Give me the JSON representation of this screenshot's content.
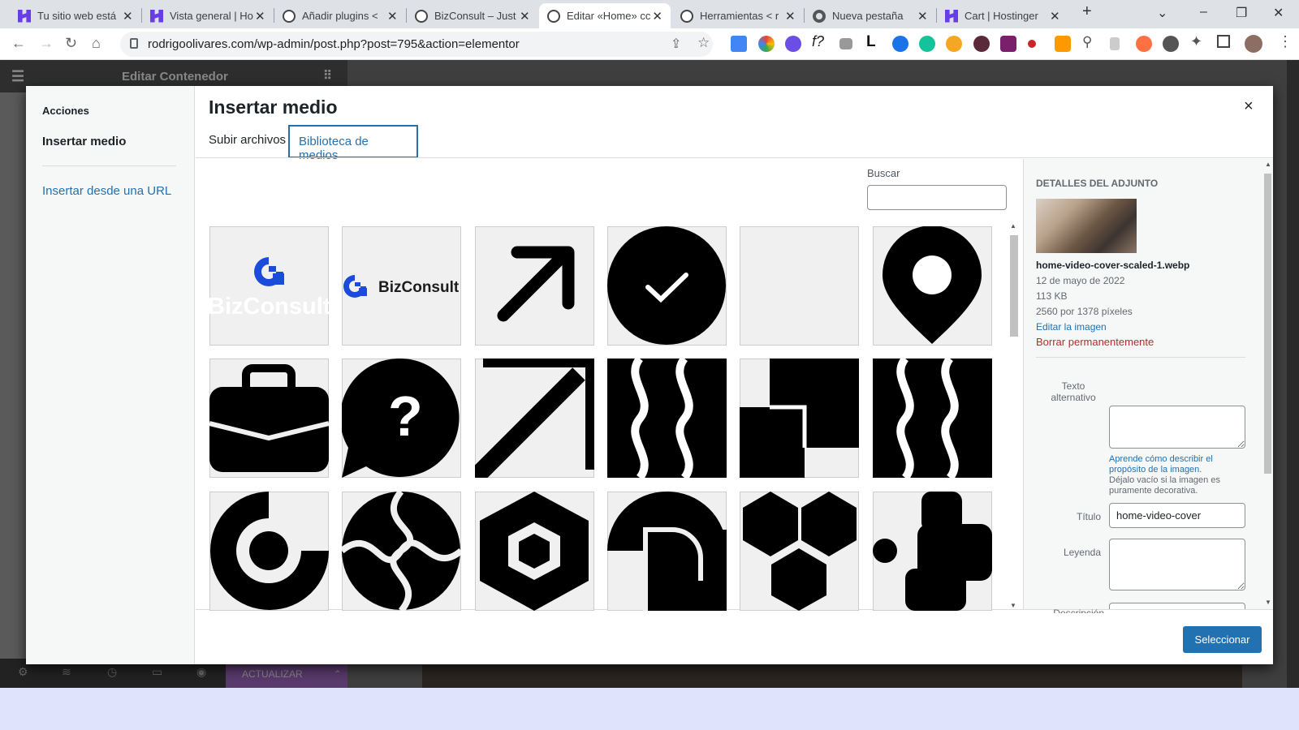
{
  "tabs": [
    {
      "title": "Tu sitio web está",
      "icon": "hostinger-icon"
    },
    {
      "title": "Vista general | Ho",
      "icon": "hostinger-icon"
    },
    {
      "title": "Añadir plugins <",
      "icon": "wordpress-icon"
    },
    {
      "title": "BizConsult – Just",
      "icon": "wordpress-icon"
    },
    {
      "title": "Editar «Home» cc",
      "icon": "wordpress-icon"
    },
    {
      "title": "Herramientas < r",
      "icon": "wordpress-icon"
    },
    {
      "title": "Nueva pestaña",
      "icon": "chrome-icon"
    },
    {
      "title": "Cart | Hostinger",
      "icon": "hostinger-icon"
    }
  ],
  "url": "rodrigoolivares.com/wp-admin/post.php?post=795&action=elementor",
  "elementor": {
    "panel_title": "Editar Contenedor",
    "update_label": "ACTUALIZAR"
  },
  "modal": {
    "menu_heading": "Acciones",
    "menu_current": "Insertar medio",
    "menu_url": "Insertar desde una URL",
    "title": "Insertar medio",
    "close": "×",
    "tab_upload": "Subir archivos",
    "tab_library": "Biblioteca de medios",
    "search_label": "Buscar",
    "search_value": "",
    "select_button": "Seleccionar"
  },
  "media_items": [
    {
      "icon": "bizconsult-logo-white",
      "text": "BizConsult"
    },
    {
      "icon": "bizconsult-logo-dark",
      "text": "BizConsult"
    },
    {
      "icon": "arrow-up-right-icon"
    },
    {
      "icon": "check-circle-icon"
    },
    {
      "icon": "blank-image"
    },
    {
      "icon": "map-pin-icon"
    },
    {
      "icon": "briefcase-icon"
    },
    {
      "icon": "question-bubble-icon",
      "text": "?"
    },
    {
      "icon": "arrow-up-right-large-icon"
    },
    {
      "icon": "wave-pattern-icon"
    },
    {
      "icon": "squares-shape-icon"
    },
    {
      "icon": "wave-pattern-icon"
    },
    {
      "icon": "ring-c-icon"
    },
    {
      "icon": "swirl-icon"
    },
    {
      "icon": "hexagon-icon"
    },
    {
      "icon": "shape-p-icon"
    },
    {
      "icon": "hexagons-cluster-icon"
    },
    {
      "icon": "rounded-squares-icon"
    }
  ],
  "details": {
    "heading": "Detalles del adjunto",
    "filename": "home-video-cover-scaled-1.webp",
    "date": "12 de mayo de 2022",
    "size": "113 KB",
    "dimensions": "2560 por 1378 píxeles",
    "edit_link": "Editar la imagen",
    "delete_link": "Borrar permanentemente",
    "alt_label": "Texto alternativo",
    "alt_help_link": "Aprende cómo describir el propósito de la imagen.",
    "alt_help_text": "Déjalo vacío si la imagen es puramente decorativa.",
    "title_label": "Título",
    "title_value": "home-video-cover",
    "caption_label": "Leyenda",
    "description_label": "Descripción"
  }
}
